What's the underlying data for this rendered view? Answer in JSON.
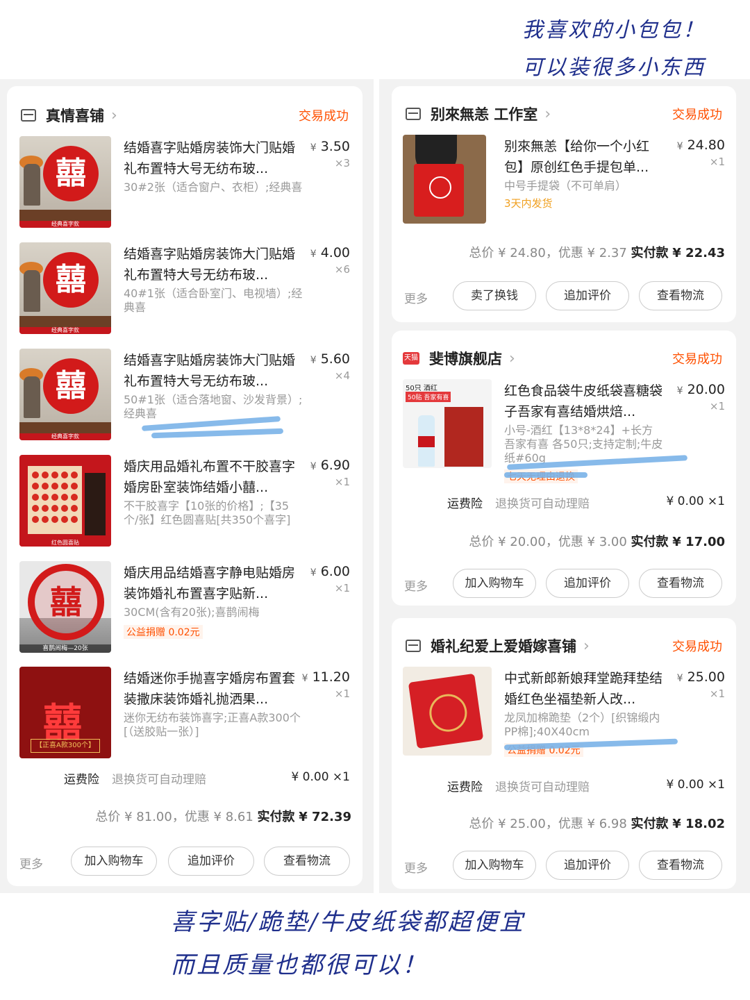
{
  "notes": {
    "top1": "我喜欢的小包包！",
    "top2": "可以装很多小东西",
    "bottom1": "喜字贴/跪垫/牛皮纸袋都超便宜",
    "bottom2": "而且质量也都很可以！"
  },
  "left_order": {
    "shop": "真情喜铺",
    "status": "交易成功",
    "items": [
      {
        "title": "结婚喜字贴婚房装饰大门贴婚礼布置特大号无纺布玻...",
        "spec": "30#2张（适合窗户、衣柜）;经典喜",
        "price": "3.50",
        "qty": "×3",
        "thumb_label": "经典喜字款"
      },
      {
        "title": "结婚喜字贴婚房装饰大门贴婚礼布置特大号无纺布玻...",
        "spec": "40#1张（适合卧室门、电视墙）;经典喜",
        "price": "4.00",
        "qty": "×6",
        "thumb_label": "经典喜字款"
      },
      {
        "title": "结婚喜字贴婚房装饰大门贴婚礼布置特大号无纺布玻...",
        "spec": "50#1张（适合落地窗、沙发背景）;经典喜",
        "price": "5.60",
        "qty": "×4",
        "thumb_label": "经典喜字款"
      },
      {
        "title": "婚庆用品婚礼布置不干胶喜字婚房卧室装饰结婚小囍...",
        "spec": "不干胶喜字【10张的价格】;【35个/张】红色圆喜贴[共350个喜字]",
        "price": "6.90",
        "qty": "×1",
        "thumb_label": "红色圆喜贴"
      },
      {
        "title": "婚庆用品结婚喜字静电贴婚房装饰婚礼布置喜字贴新...",
        "spec": "30CM(含有20张);喜鹊闹梅",
        "price": "6.00",
        "qty": "×1",
        "tag": "公益捐赠 0.02元",
        "thumb_label": "喜鹊闹梅—20张"
      },
      {
        "title": "结婚迷你手抛喜字婚房布置套装撒床装饰婚礼抛洒果...",
        "spec": "迷你无纺布装饰喜字;正喜A款300个[（送胶贴一张）]",
        "price": "11.20",
        "qty": "×1",
        "thumb_label": "【正喜A款300个】"
      }
    ],
    "insurance_label": "运费险",
    "insurance_desc": "退换货可自动理赔",
    "insurance_value": "¥ 0.00 ×1",
    "total_text": "总价 ¥ 81.00，优惠 ¥ 8.61",
    "pay_label": "实付款",
    "pay_value": "¥ 72.39",
    "more": "更多",
    "buttons": [
      "加入购物车",
      "追加评价",
      "查看物流"
    ]
  },
  "right_orders": [
    {
      "shop": "别來無恙 工作室",
      "status": "交易成功",
      "item": {
        "title": "别來無恙【给你一个小红包】原创红色手提包单...",
        "spec": "中号手提袋（不可单肩）",
        "tag": "3天内发货",
        "price": "24.80",
        "qty": "×1"
      },
      "total_text": "总价 ¥ 24.80，优惠 ¥ 2.37",
      "pay_label": "实付款",
      "pay_value": "¥ 22.43",
      "more": "更多",
      "buttons": [
        "卖了换钱",
        "追加评价",
        "查看物流"
      ]
    },
    {
      "shop": "斐博旗舰店",
      "shop_badge": "天猫",
      "status": "交易成功",
      "item": {
        "title": "红色食品袋牛皮纸袋喜糖袋子吾家有喜结婚烘焙...",
        "spec": "小号-酒红【13*8*24】+长方吾家有喜 各50只;支持定制;牛皮纸#60g",
        "tag": "七天无理由退换",
        "price": "20.00",
        "qty": "×1",
        "thumb_head": "50只 酒红",
        "thumb_tag": "50贴 吾家有喜"
      },
      "insurance_label": "运费险",
      "insurance_desc": "退换货可自动理赔",
      "insurance_value": "¥ 0.00 ×1",
      "total_text": "总价 ¥ 20.00，优惠 ¥ 3.00",
      "pay_label": "实付款",
      "pay_value": "¥ 17.00",
      "more": "更多",
      "buttons": [
        "加入购物车",
        "追加评价",
        "查看物流"
      ]
    },
    {
      "shop": "婚礼纪爱上爱婚嫁喜铺",
      "status": "交易成功",
      "item": {
        "title": "中式新郎新娘拜堂跪拜垫结婚红色坐福垫新人改...",
        "spec": "龙凤加棉跪垫（2个）[织锦缎内PP棉];40X40cm",
        "tag": "公益捐赠 0.02元",
        "price": "25.00",
        "qty": "×1"
      },
      "insurance_label": "运费险",
      "insurance_desc": "退换货可自动理赔",
      "insurance_value": "¥ 0.00 ×1",
      "total_text": "总价 ¥ 25.00，优惠 ¥ 6.98",
      "pay_label": "实付款",
      "pay_value": "¥ 18.02",
      "more": "更多",
      "buttons": [
        "加入购物车",
        "追加评价",
        "查看物流"
      ]
    }
  ],
  "currency": "¥",
  "colors": {
    "accent": "#ff5000",
    "handwriting": "#1f2f8c",
    "scribble": "#7ab3e8"
  }
}
